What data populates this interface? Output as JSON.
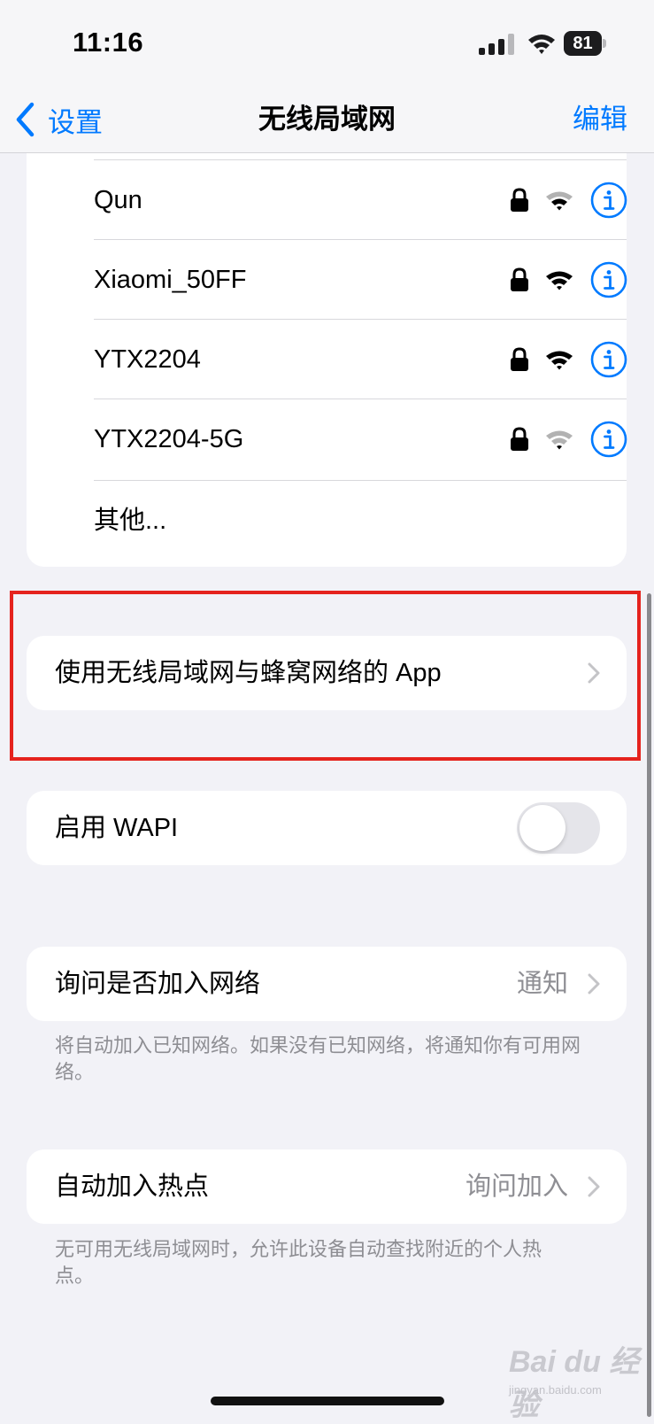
{
  "status_bar": {
    "time": "11:16",
    "battery_level": "81"
  },
  "nav": {
    "back_label": "设置",
    "title": "无线局域网",
    "edit_label": "编辑"
  },
  "networks": [
    {
      "name": "Qun",
      "locked": true,
      "signal": "medium"
    },
    {
      "name": "Xiaomi_50FF",
      "locked": true,
      "signal": "full"
    },
    {
      "name": "YTX2204",
      "locked": true,
      "signal": "full"
    },
    {
      "name": "YTX2204-5G",
      "locked": true,
      "signal": "weak"
    }
  ],
  "other_label": "其他...",
  "apps_row": {
    "label": "使用无线局域网与蜂窝网络的 App"
  },
  "wapi_row": {
    "label": "启用 WAPI",
    "enabled": false
  },
  "ask_join": {
    "label": "询问是否加入网络",
    "value": "通知",
    "footnote": "将自动加入已知网络。如果没有已知网络，将通知你有可用网络。"
  },
  "auto_hotspot": {
    "label": "自动加入热点",
    "value": "询问加入",
    "footnote": "无可用无线局域网时，允许此设备自动查找附近的个人热点。"
  },
  "watermark": {
    "brand": "Bai du 经验",
    "url": "jingyan.baidu.com"
  },
  "colors": {
    "accent": "#007aff",
    "highlight": "#e5231e",
    "background": "#f2f2f7"
  }
}
